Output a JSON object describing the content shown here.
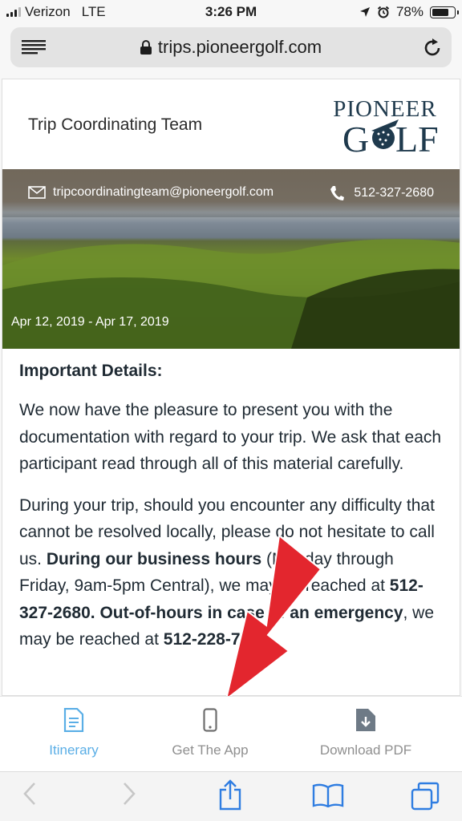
{
  "status_bar": {
    "carrier": "Verizon",
    "network": "LTE",
    "time": "3:26 PM",
    "battery": "78%",
    "battery_level": 0.78,
    "icons": [
      "signal-icon",
      "location-icon",
      "alarm-icon",
      "battery-icon"
    ]
  },
  "browser": {
    "url": "trips.pioneergolf.com",
    "icons": [
      "menu-icon",
      "lock-icon",
      "reload-icon"
    ]
  },
  "header": {
    "team_name": "Trip Coordinating Team",
    "logo_top": "PIONEER",
    "logo_bottom": "GOLF"
  },
  "hero": {
    "email": "tripcoordinatingteam@pioneergolf.com",
    "phone": "512-327-2680",
    "dates": "Apr 12, 2019 - Apr 17, 2019"
  },
  "content": {
    "heading": "Important Details:",
    "para1": "We now have the pleasure to present you with the documentation with regard to your trip. We ask that each participant read through all of this material carefully.",
    "p2_a": "During your trip, should you encounter any difficulty that cannot be resolved locally, please do not hesitate to call us. ",
    "p2_b": "During our business hours",
    "p2_c": " (Monday through Friday, 9am-5pm Central), we may be reached at ",
    "p2_d": "512-327-2680.",
    "p2_e": " ",
    "p2_f": "Out-of-hours in case of an emergency",
    "p2_g": ", we may be reached at ",
    "p2_h": "512-228-7727",
    "p2_i": "."
  },
  "tabs": [
    {
      "label": "Itinerary",
      "icon": "document-icon",
      "active": true
    },
    {
      "label": "Get The App",
      "icon": "phone-icon",
      "active": false
    },
    {
      "label": "Download PDF",
      "icon": "download-file-icon",
      "active": false
    }
  ],
  "colors": {
    "accent": "#5aaee6",
    "brand_navy": "#1f3a4d",
    "annotation_arrow": "#e3262e"
  }
}
